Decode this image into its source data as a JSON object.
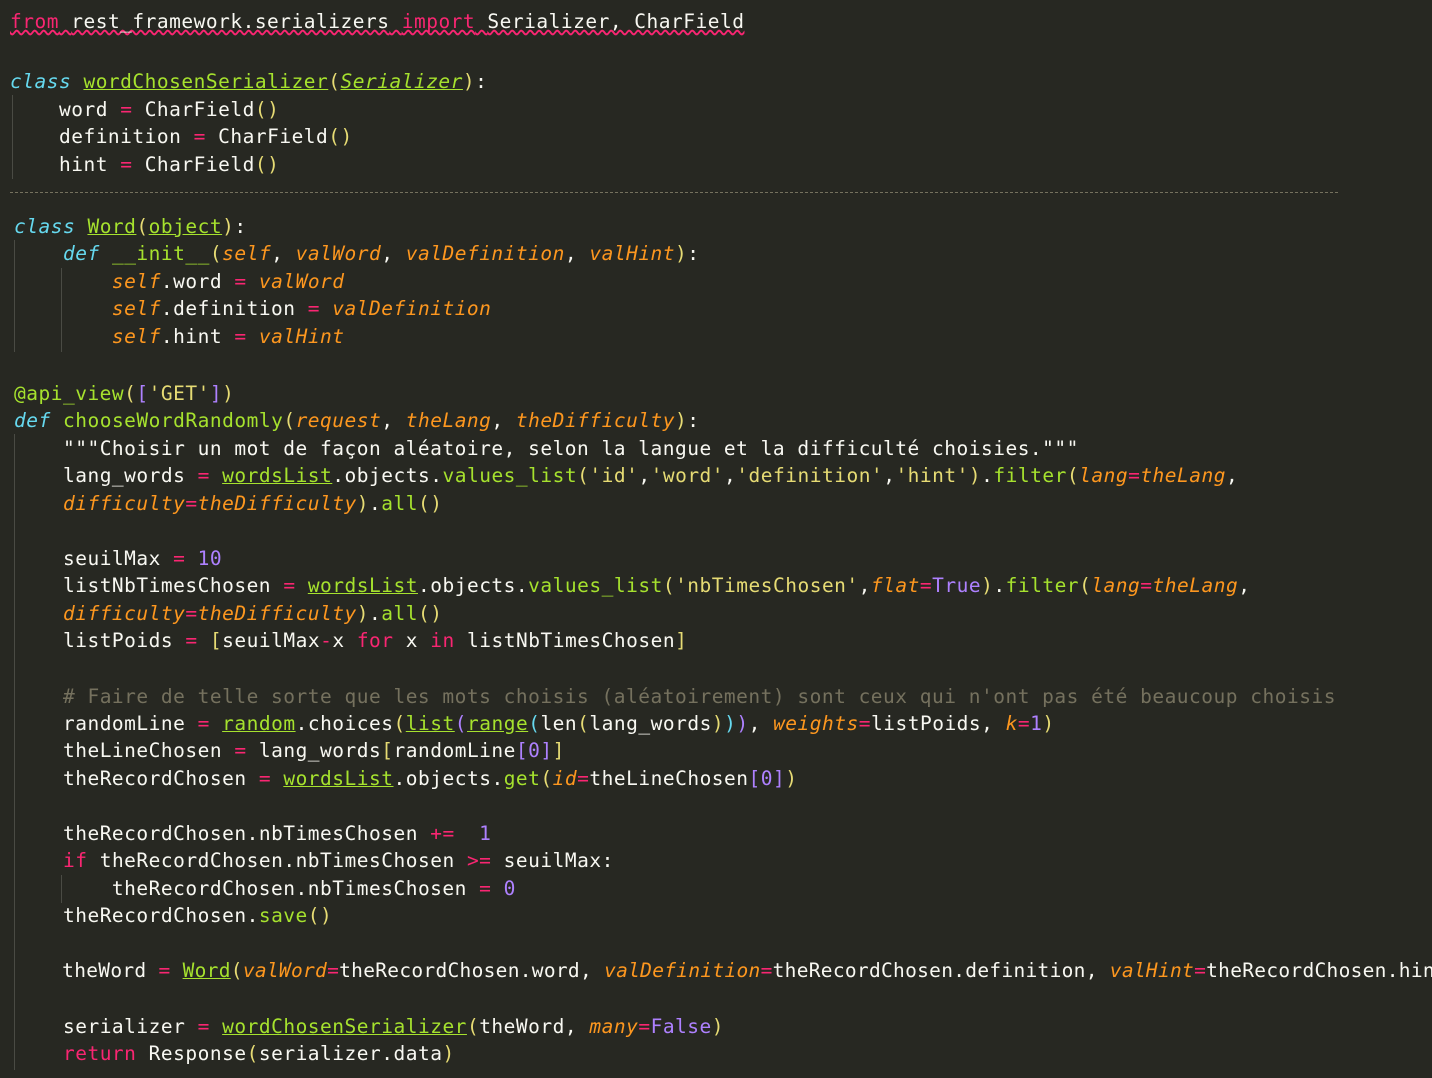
{
  "editor": {
    "language": "python",
    "theme_colors": {
      "background": "#272822",
      "foreground": "#f8f8f2",
      "keyword": "#f92672",
      "storage": "#66d9ef",
      "function": "#a6e22e",
      "parameter": "#fd971f",
      "string": "#e6db74",
      "number": "#ae81ff",
      "comment": "#75715e"
    },
    "code": {
      "l1_from": "from",
      "l1_module": "rest_framework.serializers",
      "l1_import": "import",
      "l1_names": "Serializer, CharField",
      "l2_class": "class",
      "l2_name": "wordChosenSerializer",
      "l2_base": "Serializer",
      "l3_attr": "word",
      "l4_attr": "definition",
      "l5_attr": "hint",
      "charfield": "CharField",
      "l6_class": "class",
      "l6_name": "Word",
      "l6_base": "object",
      "l7_def": "def",
      "l7_name": "__init__",
      "self": "self",
      "valWord": "valWord",
      "valDefinition": "valDefinition",
      "valHint": "valHint",
      "decorator": "@api_view",
      "get_str": "'GET'",
      "def2": "def",
      "func_name": "chooseWordRandomly",
      "request": "request",
      "theLang": "theLang",
      "theDifficulty": "theDifficulty",
      "docstring": "\"\"\"Choisir un mot de façon aléatoire, selon la langue et la difficulté choisies.\"\"\"",
      "lang_words": "lang_words",
      "wordsList": "wordsList",
      "objects": "objects",
      "values_list": "values_list",
      "s_id": "'id'",
      "s_word": "'word'",
      "s_definition": "'definition'",
      "s_hint": "'hint'",
      "filter": "filter",
      "lang_kw": "lang",
      "difficulty_kw": "difficulty",
      "all": "all",
      "seuilMax": "seuilMax",
      "ten": "10",
      "listNbTimesChosen": "listNbTimesChosen",
      "s_nbTimesChosen": "'nbTimesChosen'",
      "flat_kw": "flat",
      "true_val": "True",
      "listPoids": "listPoids",
      "for_kw": "for",
      "in_kw": "in",
      "x_var": "x",
      "comment": "# Faire de telle sorte que les mots choisis (aléatoirement) sont ceux qui n'ont pas été beaucoup choisis",
      "randomLine": "randomLine",
      "random": "random",
      "choices": "choices",
      "list_fn": "list",
      "range_fn": "range",
      "len_fn": "len",
      "weights_kw": "weights",
      "k_kw": "k",
      "one": "1",
      "zero": "0",
      "theLineChosen": "theLineChosen",
      "theRecordChosen": "theRecordChosen",
      "get_fn": "get",
      "id_kw": "id",
      "nbTimesChosen": "nbTimesChosen",
      "if_kw": "if",
      "save_fn": "save",
      "theWord": "theWord",
      "Word": "Word",
      "valWord_kw": "valWord",
      "valDefinition_kw": "valDefinition",
      "valHint_kw": "valHint",
      "word_attr": "word",
      "definition_attr": "definition",
      "hint_attr": "hint",
      "serializer": "serializer",
      "wordChosenSerializer": "wordChosenSerializer",
      "many_kw": "many",
      "false_val": "False",
      "return_kw": "return",
      "Response": "Response",
      "data_attr": "data"
    }
  }
}
